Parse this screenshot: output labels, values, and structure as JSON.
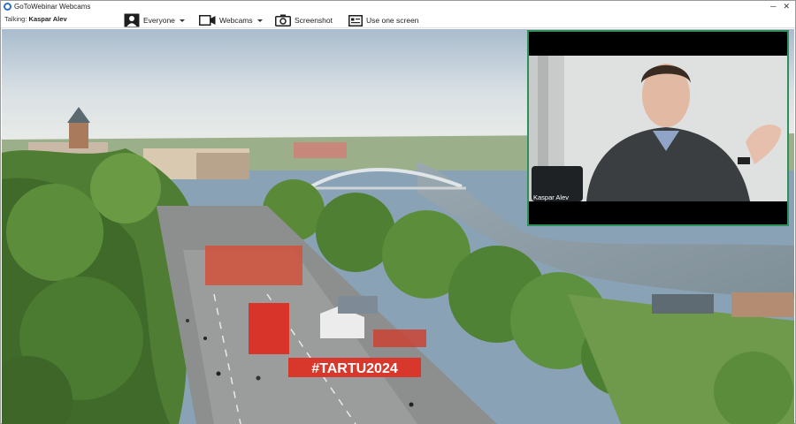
{
  "window": {
    "title": "GoToWebinar Webcams",
    "minimize_icon": "minimize-icon",
    "close_icon": "close-icon",
    "minimize_glyph": "─",
    "close_glyph": "✕"
  },
  "toolbar": {
    "talking_label": "Talking:",
    "talking_name": "Kaspar Alev",
    "audience_label": "Everyone",
    "webcams_label": "Webcams",
    "screenshot_label": "Screenshot",
    "one_screen_label": "Use one screen"
  },
  "stage": {
    "banner_text": "#TARTU2024"
  },
  "presenter": {
    "name": "Kaspar Alev"
  },
  "colors": {
    "presenter_border": "#2f8f5a",
    "banner": "#d8372c",
    "sky": "#dfe6ea",
    "river": "#8a9aa6"
  }
}
